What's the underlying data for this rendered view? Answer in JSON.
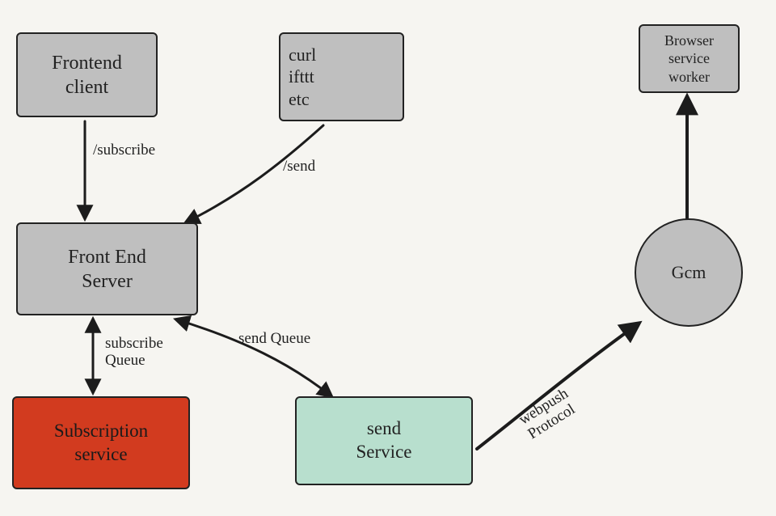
{
  "nodes": {
    "frontend_client": "Frontend\nclient",
    "curl_box": "curl\nifttt\netc",
    "front_end_server": "Front End\nServer",
    "subscription_service": "Subscription\nservice",
    "send_service": "send\nService",
    "gcm": "Gcm",
    "browser_worker": "Browser\nservice\nworker"
  },
  "edges": {
    "subscribe": "/subscribe",
    "send": "/send",
    "subscribe_queue": "subscribe\nQueue",
    "send_queue": "send Queue",
    "webpush_protocol": "webpush\nProtocol"
  }
}
